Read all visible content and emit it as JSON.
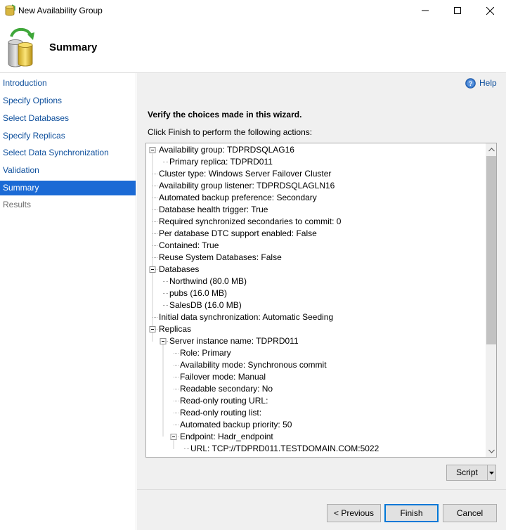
{
  "window": {
    "title": "New Availability Group",
    "icons": {
      "app": "database-cylinder-icon",
      "minimize": "minimize-icon",
      "maximize": "maximize-icon",
      "close": "close-icon"
    }
  },
  "header": {
    "title": "Summary",
    "icon": "database-refresh-icon"
  },
  "sidebar": {
    "items": [
      {
        "label": "Introduction",
        "state": "link"
      },
      {
        "label": "Specify Options",
        "state": "link"
      },
      {
        "label": "Select Databases",
        "state": "link"
      },
      {
        "label": "Specify Replicas",
        "state": "link"
      },
      {
        "label": "Select Data Synchronization",
        "state": "link"
      },
      {
        "label": "Validation",
        "state": "link"
      },
      {
        "label": "Summary",
        "state": "selected"
      },
      {
        "label": "Results",
        "state": "disabled"
      }
    ]
  },
  "main": {
    "help_label": "Help",
    "verify_text": "Verify the choices made in this wizard.",
    "instruction_text": "Click Finish to perform the following actions:",
    "tree": [
      {
        "text": "Availability group: TDPRDSQLAG16",
        "level": 0,
        "expandable": true
      },
      {
        "text": "Primary replica: TDPRD011",
        "level": 1,
        "expandable": false
      },
      {
        "text": "Cluster type: Windows Server Failover Cluster",
        "level": 0,
        "expandable": false
      },
      {
        "text": "Availability group listener: TDPRDSQLAGLN16",
        "level": 0,
        "expandable": false
      },
      {
        "text": "Automated backup preference: Secondary",
        "level": 0,
        "expandable": false
      },
      {
        "text": "Database health trigger: True",
        "level": 0,
        "expandable": false
      },
      {
        "text": "Required synchronized secondaries to commit: 0",
        "level": 0,
        "expandable": false
      },
      {
        "text": "Per database DTC support enabled: False",
        "level": 0,
        "expandable": false
      },
      {
        "text": "Contained: True",
        "level": 0,
        "expandable": false
      },
      {
        "text": "Reuse System Databases: False",
        "level": 0,
        "expandable": false
      },
      {
        "text": "Databases",
        "level": 0,
        "expandable": true
      },
      {
        "text": "Northwind (80.0 MB)",
        "level": 1,
        "expandable": false
      },
      {
        "text": "pubs (16.0 MB)",
        "level": 1,
        "expandable": false
      },
      {
        "text": "SalesDB (16.0 MB)",
        "level": 1,
        "expandable": false
      },
      {
        "text": "Initial data synchronization: Automatic Seeding",
        "level": 0,
        "expandable": false
      },
      {
        "text": "Replicas",
        "level": 0,
        "expandable": true
      },
      {
        "text": "Server instance name: TDPRD011",
        "level": 1,
        "expandable": true
      },
      {
        "text": "Role: Primary",
        "level": 2,
        "expandable": false
      },
      {
        "text": "Availability mode: Synchronous commit",
        "level": 2,
        "expandable": false
      },
      {
        "text": "Failover mode: Manual",
        "level": 2,
        "expandable": false
      },
      {
        "text": "Readable secondary: No",
        "level": 2,
        "expandable": false
      },
      {
        "text": "Read-only routing URL:",
        "level": 2,
        "expandable": false
      },
      {
        "text": "Read-only routing list:",
        "level": 2,
        "expandable": false
      },
      {
        "text": "Automated backup priority: 50",
        "level": 2,
        "expandable": false
      },
      {
        "text": "Endpoint: Hadr_endpoint",
        "level": 2,
        "expandable": true
      },
      {
        "text": "URL: TCP://TDPRD011.TESTDOMAIN.COM:5022",
        "level": 3,
        "expandable": false
      }
    ],
    "script_label": "Script",
    "scroll_position": 0
  },
  "footer": {
    "previous_label": "< Previous",
    "finish_label": "Finish",
    "cancel_label": "Cancel"
  }
}
